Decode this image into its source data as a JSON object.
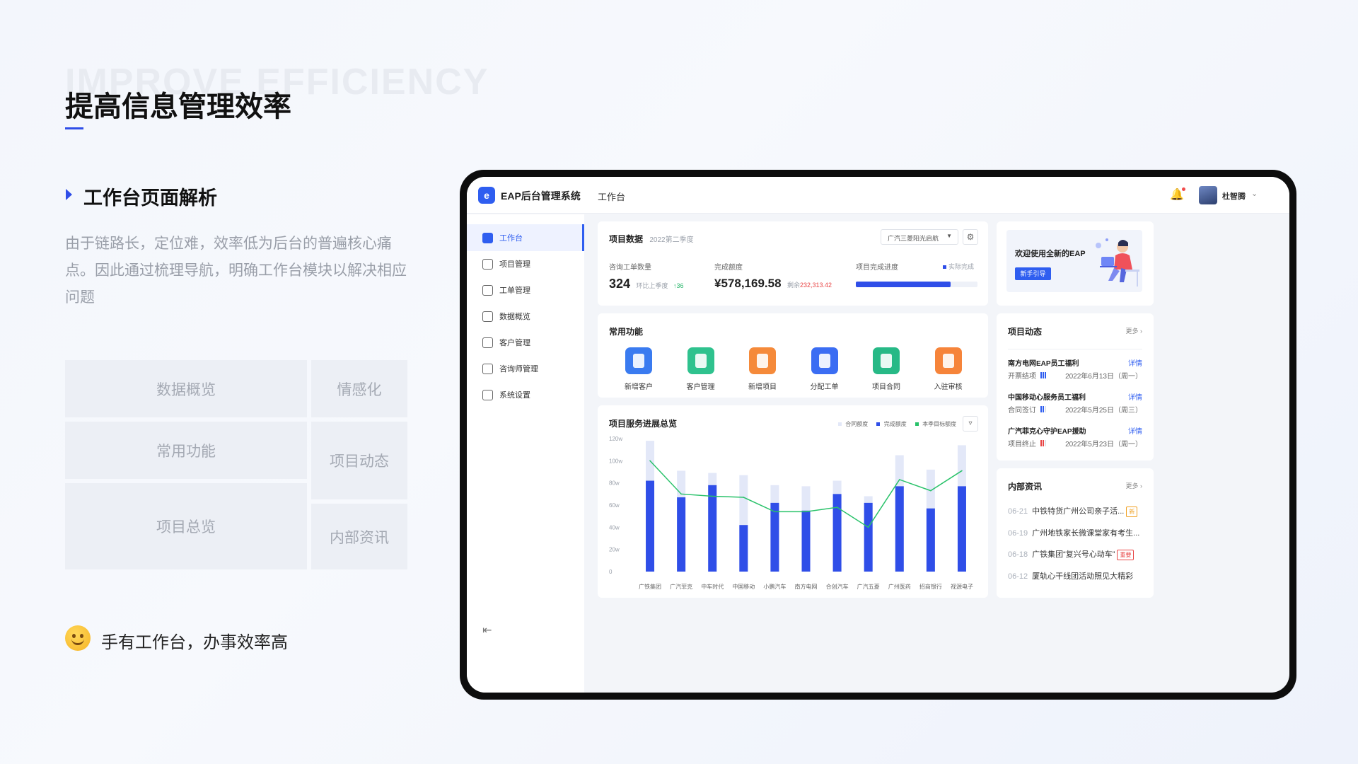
{
  "page": {
    "watermark": "IMPROVE EFFICIENCY",
    "title": "提高信息管理效率",
    "section_title": "工作台页面解析",
    "description": "由于链路长，定位难，效率低为后台的普遍核心痛点。因此通过梳理导航，明确工作台模块以解决相应问题",
    "blocks": {
      "data_overview": "数据概览",
      "emotion": "情感化",
      "common_func": "常用功能",
      "project_dynamics": "项目动态",
      "project_overview": "项目总览",
      "internal_news": "内部资讯"
    },
    "slogan": "手有工作台，办事效率高"
  },
  "app": {
    "logo_icon": "eap-logo-icon",
    "title": "EAP后台管理系统",
    "top_tab": "工作台",
    "user": "杜智腾",
    "bell_icon": "bell-icon",
    "sidebar": [
      {
        "label": "工作台",
        "icon": "dashboard-icon",
        "active": true
      },
      {
        "label": "项目管理",
        "icon": "calendar-icon"
      },
      {
        "label": "工单管理",
        "icon": "clipboard-icon"
      },
      {
        "label": "数据概览",
        "icon": "pie-icon"
      },
      {
        "label": "客户管理",
        "icon": "user-icon"
      },
      {
        "label": "咨询师管理",
        "icon": "chat-icon"
      },
      {
        "label": "系统设置",
        "icon": "gear-icon"
      }
    ],
    "project_data": {
      "title": "项目数据",
      "period": "2022第二季度",
      "select": "广汽三菱阳光启航",
      "consult_label": "咨询工单数量",
      "consult_value": "324",
      "consult_cmp": "环比上季度",
      "consult_delta": "↑36",
      "amount_label": "完成额度",
      "amount_value": "¥578,169.58",
      "amount_rest_label": "剩余",
      "amount_rest": "232,313.42",
      "progress_label": "项目完成进度",
      "progress_legend": "实际完成",
      "progress": 0.78
    },
    "welcome": {
      "text": "欢迎使用全新的EAP",
      "button": "新手引导"
    },
    "common": {
      "title": "常用功能",
      "items": [
        {
          "label": "新增客户",
          "color": "#3a7bf0"
        },
        {
          "label": "客户管理",
          "color": "#2fc28e"
        },
        {
          "label": "新增项目",
          "color": "#f58a3a"
        },
        {
          "label": "分配工单",
          "color": "#3b6df3"
        },
        {
          "label": "项目合同",
          "color": "#27b986"
        },
        {
          "label": "入驻审核",
          "color": "#f6843a"
        }
      ]
    },
    "dynamics": {
      "title": "项目动态",
      "more": "更多",
      "items": [
        {
          "title": "南方电网EAP员工福利",
          "detail": "详情",
          "status": "开票结项",
          "date": "2022年6月13日（周一）",
          "color": "#2f5ef0"
        },
        {
          "title": "中国移动心服务员工福利",
          "detail": "详情",
          "status": "合同签订",
          "date": "2022年5月25日（周三）",
          "color": "#2f5ef0"
        },
        {
          "title": "广汽菲克心守护EAP援助",
          "detail": "详情",
          "status": "项目终止",
          "date": "2022年5月23日（周一）",
          "color": "#e84545"
        }
      ]
    },
    "news": {
      "title": "内部资讯",
      "more": "更多",
      "items": [
        {
          "date": "06-21",
          "text": "中铁特货广州公司亲子活...",
          "tag": "新",
          "tag_color": "#f0a020"
        },
        {
          "date": "06-19",
          "text": "广州地铁家长微课堂家有考生...",
          "tag": ""
        },
        {
          "date": "06-18",
          "text": "广铁集团“复兴号心动车”",
          "tag": "重要",
          "tag_color": "#e84545"
        },
        {
          "date": "06-12",
          "text": "厦轨心干线团活动照见大精彩",
          "tag": ""
        }
      ]
    }
  },
  "chart_data": {
    "type": "bar",
    "title": "项目服务进展总览",
    "legend": [
      "合同额度",
      "完成额度",
      "本季目标额度"
    ],
    "legend_placement": "top-right",
    "categories": [
      "广铁集团",
      "广汽菲克",
      "中车时代",
      "中国移动",
      "小鹏汽车",
      "南方电网",
      "合创汽车",
      "广汽五菱",
      "广州医药",
      "招商银行",
      "视源电子"
    ],
    "y_ticks": [
      "0",
      "20w",
      "40w",
      "60w",
      "80w",
      "100w",
      "120w"
    ],
    "ylim": [
      0,
      120
    ],
    "series": [
      {
        "name": "合同额度",
        "type": "bar",
        "color": "#e3e8f8",
        "values": [
          118,
          91,
          89,
          87,
          78,
          77,
          82,
          68,
          105,
          92,
          114
        ]
      },
      {
        "name": "完成额度",
        "type": "bar",
        "color": "#2f4ee8",
        "values": [
          82,
          67,
          78,
          42,
          62,
          55,
          70,
          62,
          77,
          57,
          77
        ]
      },
      {
        "name": "本季目标额度",
        "type": "line",
        "color": "#29c26a",
        "values": [
          100,
          70,
          68,
          67,
          54,
          54,
          58,
          40,
          83,
          73,
          91
        ]
      }
    ]
  }
}
